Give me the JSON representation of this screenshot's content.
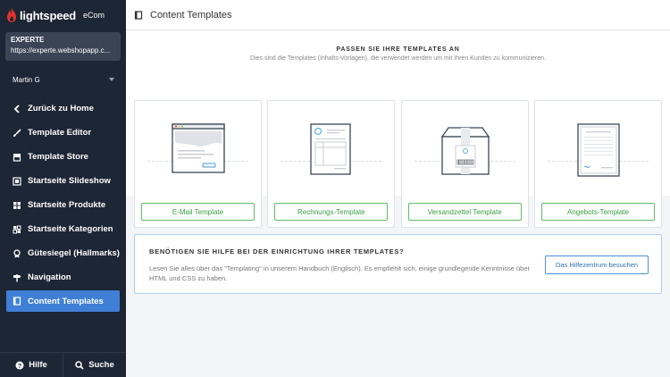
{
  "brand": {
    "name": "lightspeed",
    "product": "eCom"
  },
  "shop": {
    "name": "EXPERTE",
    "url": "https://experte.webshopapp.c..."
  },
  "user": {
    "name": "Martin G"
  },
  "nav": [
    {
      "label": "Zurück zu Home",
      "icon": "chevron-left-icon"
    },
    {
      "label": "Template Editor",
      "icon": "brush-icon"
    },
    {
      "label": "Template Store",
      "icon": "store-icon"
    },
    {
      "label": "Startseite Slideshow",
      "icon": "slides-icon"
    },
    {
      "label": "Startseite Produkte",
      "icon": "grid-icon"
    },
    {
      "label": "Startseite Kategorien",
      "icon": "grid-icon"
    },
    {
      "label": "Gütesiegel (Hallmarks)",
      "icon": "award-icon"
    },
    {
      "label": "Navigation",
      "icon": "signpost-icon"
    },
    {
      "label": "Content Templates",
      "icon": "book-icon",
      "active": true
    }
  ],
  "footer": {
    "help": "Hilfe",
    "search": "Suche"
  },
  "topbar": {
    "title": "Content Templates"
  },
  "hero": {
    "heading": "PASSEN SIE IHRE TEMPLATES AN",
    "subtitle": "Dies sind die Templates (Inhalts-Vorlagen), die verwendet werden um mit Ihren Kunden zu kommunizieren."
  },
  "cards": [
    {
      "label": "E-Mail Template"
    },
    {
      "label": "Rechnungs-Template"
    },
    {
      "label": "Versandzettel Template"
    },
    {
      "label": "Angebots-Template"
    }
  ],
  "help": {
    "title": "BENÖTIGEN SIE HILFE BEI DER EINRICHTUNG IHRER TEMPLATES?",
    "text": "Lesen Sie alles über das \"Templating\" in unserem Handbuch (Englisch). Es empfiehlt sich, einige grundlegende Kenntnisse über HTML und CSS zu haben.",
    "button": "Das Hilfezentrum besuchen"
  },
  "colors": {
    "sidebar": "#1c2634",
    "active": "#3f7fd6",
    "green": "#5fbd66",
    "blue": "#4a90d9"
  }
}
